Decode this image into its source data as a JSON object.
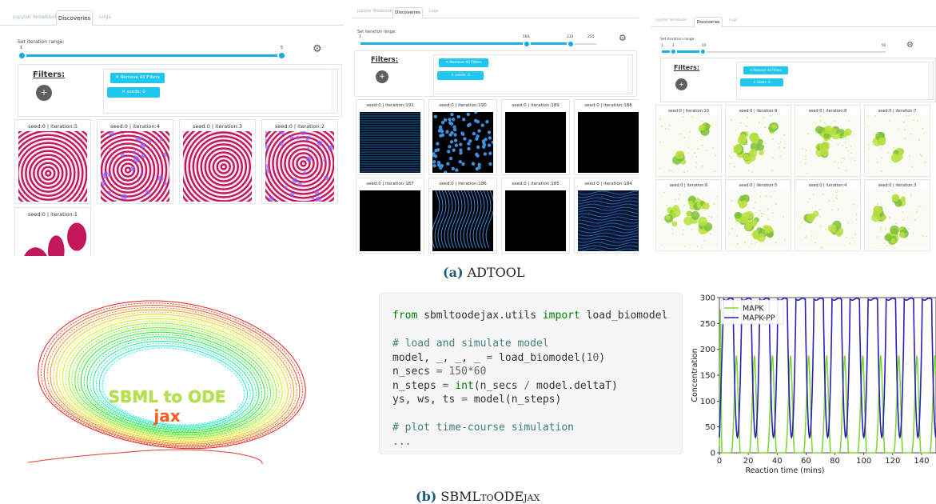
{
  "adtool": {
    "tabs": [
      "Jupyter Notebook",
      "Discoveries",
      "Logs"
    ],
    "range_label": "Set iteration range:",
    "filters_label": "Filters:",
    "add_filter_label": "+",
    "remove_all_label": "✕ Remove All Filters",
    "seed_filter_label": "✕ seeds: 0",
    "gear_icon": "gear-icon",
    "panels": [
      {
        "ticks": [
          "1",
          "5"
        ],
        "range": [
          1,
          5
        ],
        "cards": [
          {
            "caption": "seed:0 | iteration:5"
          },
          {
            "caption": "seed:0 | iteration:4"
          },
          {
            "caption": "seed:0 | iteration:3"
          },
          {
            "caption": "seed:0 | iteration:2"
          },
          {
            "caption": "seed:0 | iteration:1"
          }
        ]
      },
      {
        "ticks": [
          "1",
          "183",
          "231",
          "255"
        ],
        "range": [
          183,
          231
        ],
        "cards": [
          {
            "caption": "seed:0 | iteration:191"
          },
          {
            "caption": "seed:0 | iteration:190"
          },
          {
            "caption": "seed:0 | iteration:189"
          },
          {
            "caption": "seed:0 | iteration:188"
          },
          {
            "caption": "seed:0 | iteration:187"
          },
          {
            "caption": "seed:0 | iteration:186"
          },
          {
            "caption": "seed:0 | iteration:185"
          },
          {
            "caption": "seed:0 | iteration:184"
          }
        ]
      },
      {
        "ticks": [
          "1",
          "3",
          "10",
          "50"
        ],
        "range": [
          3,
          10
        ],
        "cards": [
          {
            "caption": "seed:0 | iteration:10"
          },
          {
            "caption": "seed:0 | iteration:9"
          },
          {
            "caption": "seed:0 | iteration:8"
          },
          {
            "caption": "seed:0 | iteration:7"
          },
          {
            "caption": "seed:0 | iteration:6"
          },
          {
            "caption": "seed:0 | iteration:5"
          },
          {
            "caption": "seed:0 | iteration:4"
          },
          {
            "caption": "seed:0 | iteration:3"
          }
        ]
      }
    ],
    "caption_letter": "(a)",
    "caption_text": "ADTOOL"
  },
  "logo": {
    "line1": "SBML to ODE",
    "line2": "jax"
  },
  "code": {
    "lines": [
      [
        {
          "t": "from",
          "c": "kw"
        },
        {
          "t": " sbmltoodejax.utils ",
          "c": "ident"
        },
        {
          "t": "import",
          "c": "kw"
        },
        {
          "t": " load_biomodel",
          "c": "ident"
        }
      ],
      [],
      [
        {
          "t": "# load and simulate model",
          "c": "comment"
        }
      ],
      [
        {
          "t": "model, _, _, _ ",
          "c": "ident"
        },
        {
          "t": "=",
          "c": "op"
        },
        {
          "t": " load_biomodel(",
          "c": "ident"
        },
        {
          "t": "10",
          "c": "num"
        },
        {
          "t": ")",
          "c": "ident"
        }
      ],
      [
        {
          "t": "n_secs ",
          "c": "ident"
        },
        {
          "t": "=",
          "c": "op"
        },
        {
          "t": " ",
          "c": "ident"
        },
        {
          "t": "150",
          "c": "num"
        },
        {
          "t": "*",
          "c": "op"
        },
        {
          "t": "60",
          "c": "num"
        }
      ],
      [
        {
          "t": "n_steps ",
          "c": "ident"
        },
        {
          "t": "=",
          "c": "op"
        },
        {
          "t": " ",
          "c": "ident"
        },
        {
          "t": "int",
          "c": "kw"
        },
        {
          "t": "(n_secs ",
          "c": "ident"
        },
        {
          "t": "/",
          "c": "op"
        },
        {
          "t": " model.deltaT)",
          "c": "ident"
        }
      ],
      [
        {
          "t": "ys, ws, ts ",
          "c": "ident"
        },
        {
          "t": "=",
          "c": "op"
        },
        {
          "t": " model(n_steps)",
          "c": "ident"
        }
      ],
      [],
      [
        {
          "t": "# plot time-course simulation",
          "c": "comment"
        }
      ],
      [
        {
          "t": "...",
          "c": "op"
        }
      ]
    ]
  },
  "chart_data": {
    "type": "line",
    "xlabel": "Reaction time (mins)",
    "ylabel": "Concentration",
    "xlim": [
      0,
      150
    ],
    "ylim": [
      0,
      300
    ],
    "xticks": [
      "0",
      "20",
      "40",
      "60",
      "80",
      "100",
      "120",
      "140"
    ],
    "yticks": [
      "0",
      "50",
      "100",
      "150",
      "200",
      "250",
      "300"
    ],
    "legend_position": "top-left",
    "series": [
      {
        "name": "MAPK",
        "color": "#7fd63b",
        "period": 12.5,
        "min": 0,
        "max": 205,
        "first_peak": 3
      },
      {
        "name": "MAPK-PP",
        "color": "#2a1fb8",
        "period": 12.5,
        "min": 30,
        "max": 297,
        "first_peak": 8
      }
    ]
  },
  "caption_b": {
    "letter": "(b)",
    "text": "SBMLtoODEjax"
  }
}
